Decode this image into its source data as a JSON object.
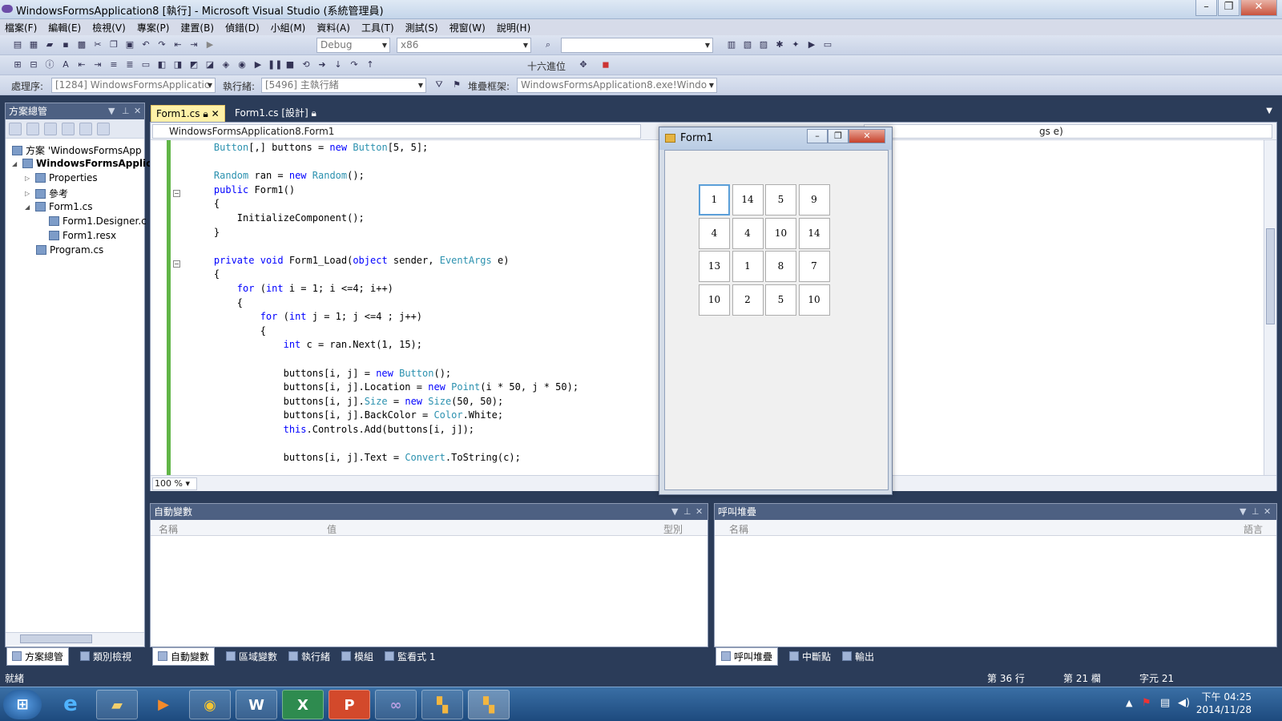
{
  "window": {
    "title": "WindowsFormsApplication8 [執行] - Microsoft Visual Studio (系統管理員)"
  },
  "menu": [
    "檔案(F)",
    "編輯(E)",
    "檢視(V)",
    "專案(P)",
    "建置(B)",
    "偵錯(D)",
    "小組(M)",
    "資料(A)",
    "工具(T)",
    "測試(S)",
    "視窗(W)",
    "說明(H)"
  ],
  "toolbar1": {
    "config": "Debug",
    "platform": "x86",
    "find": ""
  },
  "toolbar2": {
    "hex_label": "十六進位"
  },
  "toolbar3": {
    "process_label": "處理序:",
    "process_value": "[1284] WindowsFormsApplicatic",
    "thread_label": "執行緒:",
    "thread_value": "[5496] 主執行緒",
    "stack_label": "堆疊框架:",
    "stack_value": "WindowsFormsApplication8.exe!Windo"
  },
  "solution": {
    "title": "方案總管",
    "items": [
      {
        "label": "方案 'WindowsFormsApp"
      },
      {
        "label": "WindowsFormsApplic"
      },
      {
        "label": "Properties"
      },
      {
        "label": "參考"
      },
      {
        "label": "Form1.cs"
      },
      {
        "label": "Form1.Designer.c"
      },
      {
        "label": "Form1.resx"
      },
      {
        "label": "Program.cs"
      }
    ]
  },
  "tabs": [
    {
      "label": "Form1.cs"
    },
    {
      "label": "Form1.cs [設計]"
    }
  ],
  "nav": {
    "left": "WindowsFormsApplication8.Form1",
    "right": "gs e)"
  },
  "code": [
    "Button[,] buttons = new Button[5, 5];",
    "",
    "Random ran = new Random();",
    "public Form1()",
    "{",
    "    InitializeComponent();",
    "}",
    "",
    "private void Form1_Load(object sender, EventArgs e)",
    "{",
    "    for (int i = 1; i <=4; i++)",
    "    {",
    "        for (int j = 1; j <=4 ; j++)",
    "        {",
    "            int c = ran.Next(1, 15);",
    "",
    "            buttons[i, j] = new Button();",
    "            buttons[i, j].Location = new Point(i * 50, j * 50);",
    "            buttons[i, j].Size = new Size(50, 50);",
    "            buttons[i, j].BackColor = Color.White;",
    "            this.Controls.Add(buttons[i, j]);",
    "",
    "            buttons[i, j].Text = Convert.ToString(c);"
  ],
  "zoom": "100 %",
  "form1": {
    "title": "Form1",
    "grid": [
      [
        "1",
        "14",
        "5",
        "9"
      ],
      [
        "4",
        "4",
        "10",
        "14"
      ],
      [
        "13",
        "1",
        "8",
        "7"
      ],
      [
        "10",
        "2",
        "5",
        "10"
      ]
    ]
  },
  "autos": {
    "title": "自動變數",
    "cols": [
      "名稱",
      "值",
      "型別"
    ]
  },
  "callstack": {
    "title": "呼叫堆疊",
    "cols": [
      "名稱",
      "語言"
    ]
  },
  "bottom_tabs_left": [
    "自動變數",
    "區域變數",
    "執行緒",
    "模組",
    "監看式 1"
  ],
  "bottom_tabs_right": [
    "呼叫堆疊",
    "中斷點",
    "輸出"
  ],
  "sol_tabs": [
    "方案總管",
    "類別檢視"
  ],
  "status": {
    "ready": "就緒",
    "line": "第 36 行",
    "col": "第 21 欄",
    "ch": "字元 21"
  },
  "taskbar": {
    "time": "下午 04:25",
    "date": "2014/11/28",
    "apps": [
      "e",
      "W",
      "X",
      "P"
    ]
  },
  "colors": {
    "keyword": "#0000ff",
    "type": "#2b91af",
    "accent": "#2b3c59"
  }
}
